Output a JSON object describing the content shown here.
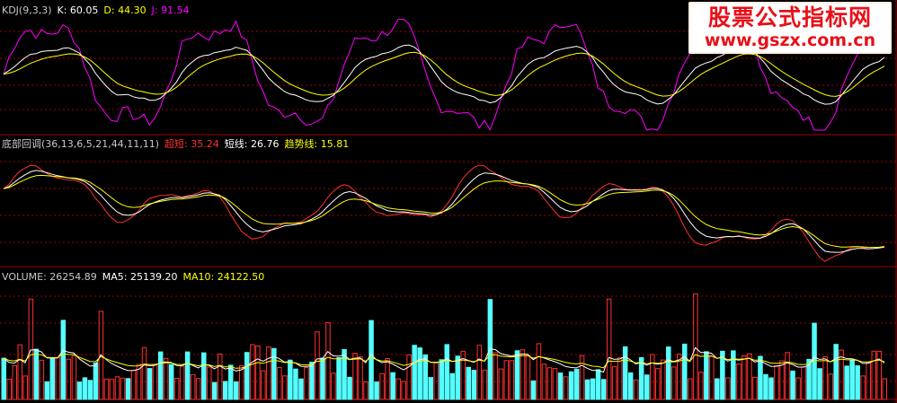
{
  "kdj": {
    "name": "KDJ(9,3,3)",
    "k_label": "K:",
    "k_value": "60.05",
    "d_label": "D:",
    "d_value": "44.30",
    "j_label": "J:",
    "j_value": "91.54"
  },
  "bottom_adjust": {
    "name": "底部回调(36,13,6,5,21,44,11,11)",
    "ultra_short_label": "超短:",
    "ultra_short_value": "35.24",
    "short_label": "短线:",
    "short_value": "26.76",
    "trend_label": "趋势线:",
    "trend_value": "15.81"
  },
  "volume": {
    "name": "VOLUME:",
    "value": "26254.89",
    "ma5_label": "MA5:",
    "ma5_value": "25139.20",
    "ma10_label": "MA10:",
    "ma10_value": "24122.50"
  },
  "watermark": {
    "title": "股票公式指标网",
    "url": "www.gszx.com.cn"
  },
  "colors": {
    "background": "#000000",
    "kdj_k": "#ffffff",
    "kdj_d": "#ffff00",
    "kdj_j": "#ff00ff",
    "ultra_short": "#ff3030",
    "short": "#ffffff",
    "trend": "#ffff00",
    "vol_up": "#ff3030",
    "vol_down": "#54ffff",
    "grid": "#a00000",
    "panel_border": "#a00000"
  }
}
